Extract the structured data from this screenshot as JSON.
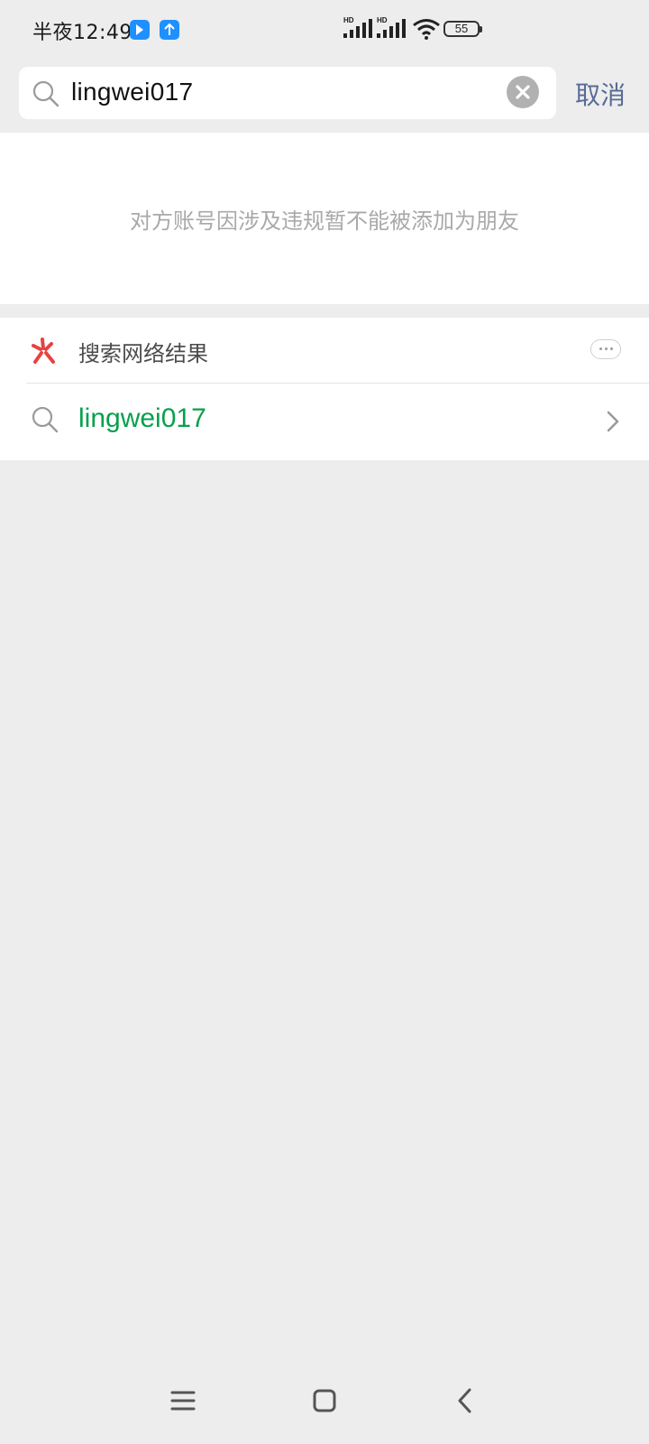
{
  "status_bar": {
    "time": "半夜12:49",
    "network_label_1": "HD",
    "network_label_2": "HD",
    "battery": "55",
    "icons": [
      "app-notification-icon",
      "upload-notification-icon",
      "signal-icon",
      "signal-icon",
      "wifi-icon",
      "battery-icon"
    ]
  },
  "search": {
    "query": "lingwei017",
    "cancel_label": "取消",
    "icons": [
      "search-icon",
      "clear-icon"
    ]
  },
  "notice": {
    "message": "对方账号因涉及违规暂不能被添加为朋友"
  },
  "web_results": {
    "title": "搜索网络结果",
    "items": [
      {
        "label": "lingwei017"
      }
    ],
    "icons": [
      "sou-logo-icon",
      "more-icon",
      "search-icon",
      "chevron-right-icon"
    ]
  },
  "navigation": {
    "icons": [
      "menu-icon",
      "home-icon",
      "back-icon"
    ]
  },
  "colors": {
    "background": "#ededed",
    "panel": "#ffffff",
    "link_blue": "#576b95",
    "result_green": "#07a04c",
    "notice_gray": "#a9a9a9",
    "sou_red": "#e64340"
  }
}
